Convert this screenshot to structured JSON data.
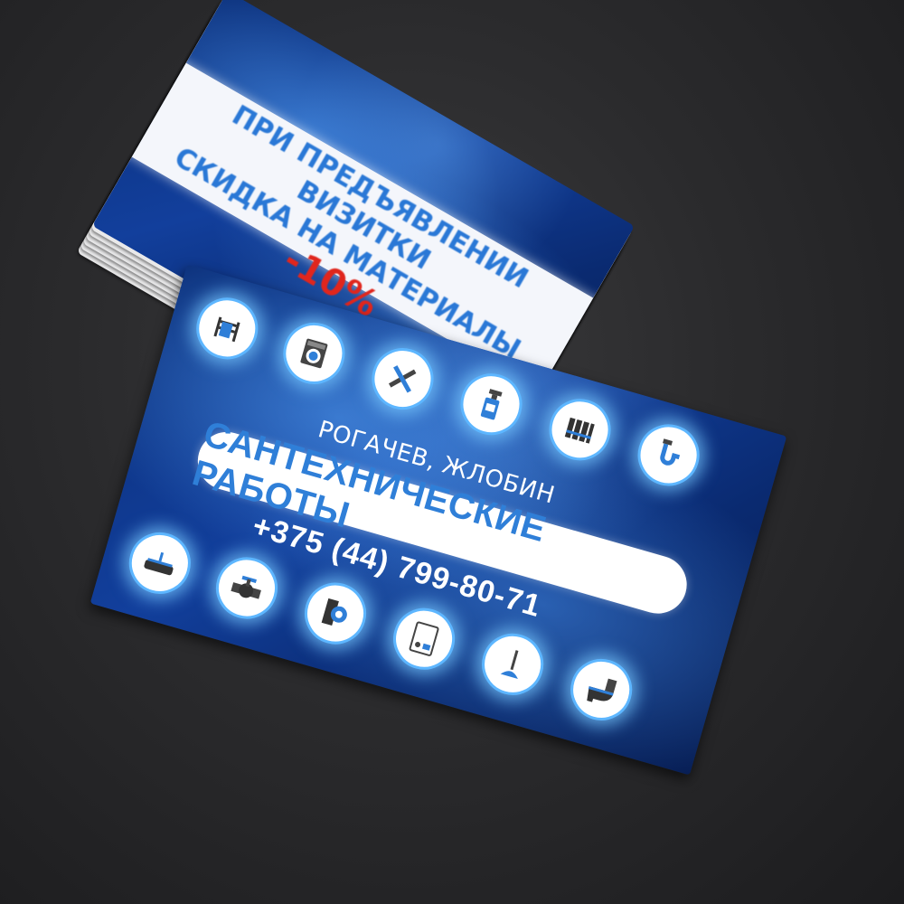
{
  "back_card": {
    "promo_line1": "ПРИ ПРЕДЪЯВЛЕНИИ ВИЗИТКИ",
    "promo_line2_text": "СКИДКА НА МАТЕРИАЛЫ ",
    "promo_discount": "-10%"
  },
  "front_card": {
    "city": "РОГАЧЕВ, ЖЛОБИН",
    "title": "САНТЕХНИЧЕСКИЕ РАБОТЫ",
    "phone": "+375 (44) 799-80-71",
    "icons_top": [
      "towel-rail-icon",
      "washing-machine-icon",
      "wrench-icon",
      "spray-bottle-icon",
      "radiator-icon",
      "siphon-icon"
    ],
    "icons_bottom": [
      "bathtub-icon",
      "valve-icon",
      "pump-icon",
      "boiler-icon",
      "plunger-icon",
      "toilet-icon"
    ]
  },
  "colors": {
    "accent_blue": "#2f7fd8",
    "discount_red": "#e0261d",
    "card_blue": "#123f9c",
    "glow": "#5db6ff"
  }
}
